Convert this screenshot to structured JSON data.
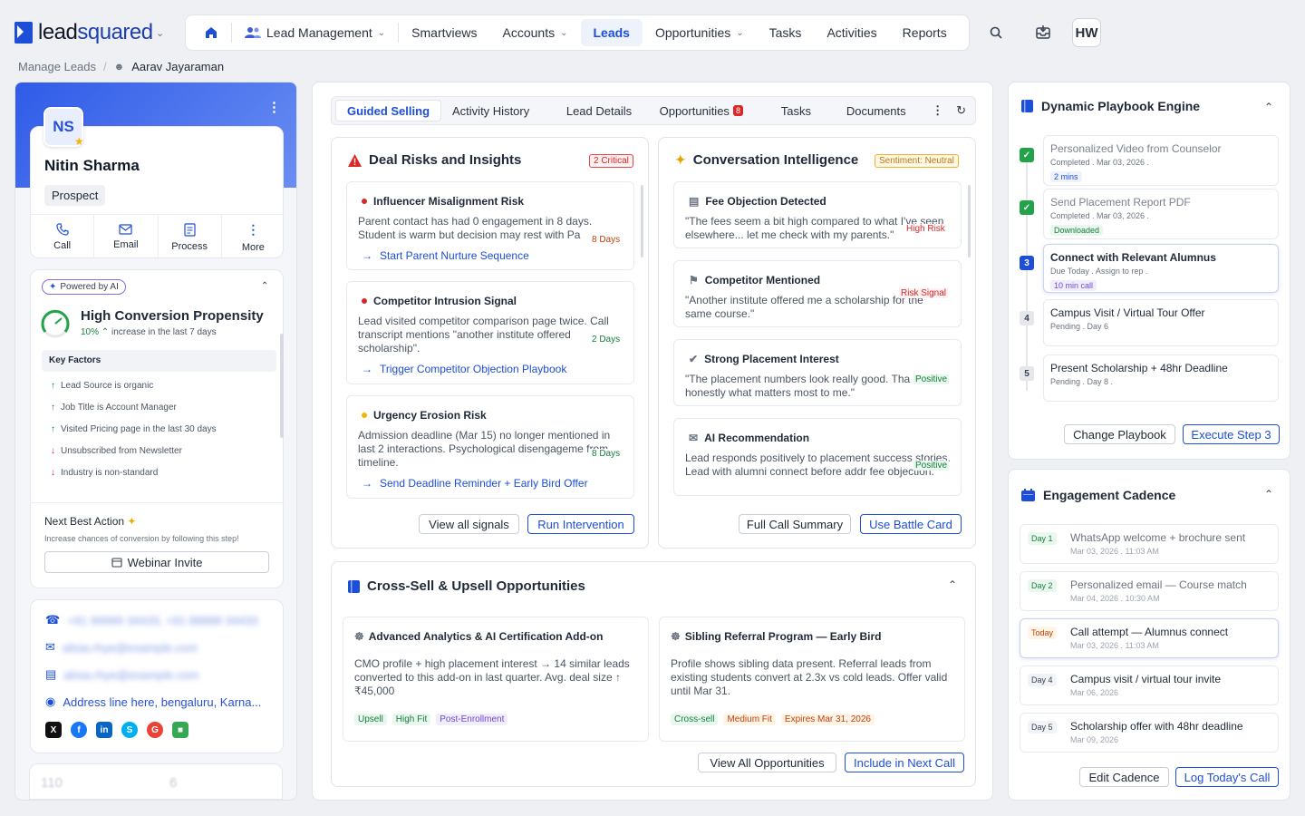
{
  "brand": {
    "name_a": "lead",
    "name_b": "squared"
  },
  "nav": {
    "module": "Lead Management",
    "items": [
      "Smartviews",
      "Accounts",
      "Leads",
      "Opportunities",
      "Tasks",
      "Activities",
      "Reports"
    ],
    "active": "Leads",
    "user_initials": "HW"
  },
  "breadcrumb": {
    "root": "Manage Leads",
    "current": "Aarav Jayaraman"
  },
  "profile": {
    "initials": "NS",
    "name": "Nitin Sharma",
    "status": "Prospect",
    "actions": [
      "Call",
      "Email",
      "Process",
      "More"
    ]
  },
  "ai": {
    "badge": "Powered by AI",
    "title": "High Conversion Propensity",
    "change_pct": "10%",
    "change_text": "increase in the last 7 days",
    "key_factors_label": "Key Factors",
    "factors": [
      {
        "text": "Lead Source is organic",
        "dir": "up"
      },
      {
        "text": "Job Title is Account Manager",
        "dir": "up"
      },
      {
        "text": "Visited Pricing page in the last 30 days",
        "dir": "up"
      },
      {
        "text": "Unsubscribed from Newsletter",
        "dir": "down"
      },
      {
        "text": "Industry is non-standard",
        "dir": "down"
      }
    ],
    "nba_title": "Next Best Action",
    "nba_sub": "Increase chances of conversion by following this step!",
    "nba_button": "Webinar Invite"
  },
  "contact": {
    "phone": "+91 99999 34433, +91 88888 34433",
    "email": "alisia.rhye@example.com",
    "alt_email": "alisia.rhye@example.com",
    "address": "Address line here, bengaluru, Karna..."
  },
  "stats": {
    "a": "110",
    "b": "6"
  },
  "tabs": [
    "Guided Selling",
    "Activity History",
    "Lead Details",
    "Opportunities",
    "Tasks",
    "Documents"
  ],
  "tabs_opportunity_count": "8",
  "deal_risks": {
    "title": "Deal Risks and Insights",
    "tag": "2 Critical",
    "items": [
      {
        "title": "Influencer Misalignment Risk",
        "body": "Parent contact has had 0 engagement in 8 days. Student is warm but decision may rest with Pa",
        "days": "8 Days",
        "link": "Start Parent Nurture Sequence"
      },
      {
        "title": "Competitor Intrusion Signal",
        "body": "Lead visited competitor comparison page twice. Call transcript mentions \"another institute offered scholarship\".",
        "days": "2 Days",
        "link": "Trigger Competitor Objection Playbook"
      },
      {
        "title": "Urgency Erosion Risk",
        "body": "Admission deadline (Mar 15) no longer mentioned in last 2 interactions. Psychological disengageme from timeline.",
        "days": "8 Days",
        "link": "Send Deadline Reminder + Early Bird Offer"
      }
    ],
    "btn_secondary": "View all signals",
    "btn_primary": "Run Intervention"
  },
  "conversation": {
    "title": "Conversation Intelligence",
    "tag": "Sentiment: Neutral",
    "items": [
      {
        "title": "Fee Objection Detected",
        "body": "\"The fees seem a bit high compared to what I've seen elsewhere... let me check with my parents.\"",
        "signal": "High Risk"
      },
      {
        "title": "Competitor Mentioned",
        "body": "\"Another institute offered me a scholarship for the same course.\"",
        "signal": "Risk Signal"
      },
      {
        "title": "Strong Placement Interest",
        "body": "\"The placement numbers look really good. Tha honestly what matters most to me.\"",
        "signal": "Positive"
      },
      {
        "title": "AI Recommendation",
        "body": "Lead responds positively to placement success stories. Lead with alumni connect before addr fee objection.",
        "signal": "Positive"
      }
    ],
    "btn_secondary": "Full Call Summary",
    "btn_primary": "Use Battle Card"
  },
  "cross_sell": {
    "title": "Cross-Sell & Upsell Opportunities",
    "items": [
      {
        "title": "Advanced Analytics & AI Certification Add-on",
        "body": "CMO profile + high placement interest → 14 similar leads converted to this add-on in last quarter. Avg. deal size ↑ ₹45,000",
        "tags": [
          "Upsell",
          "High Fit",
          "Post-Enrollment"
        ]
      },
      {
        "title": "Sibling Referral Program — Early Bird",
        "body": "Profile shows sibling data present. Referral leads from existing students convert at 2.3x vs cold leads. Offer valid until Mar 31.",
        "tags": [
          "Cross-sell",
          "Medium Fit",
          "Expires Mar 31, 2026"
        ]
      }
    ],
    "btn_secondary": "View All Opportunities",
    "btn_primary": "Include in Next Call"
  },
  "playbook": {
    "title": "Dynamic Playbook Engine",
    "steps": [
      {
        "marker": "",
        "state": "done",
        "title": "Personalized Video from Counselor",
        "sub": "Completed . Mar 03, 2026 .",
        "tag": "2 mins"
      },
      {
        "marker": "",
        "state": "done",
        "title": "Send Placement Report PDF",
        "sub": "Completed . Mar 03, 2026 .",
        "tag": "Downloaded"
      },
      {
        "marker": "3",
        "state": "cur",
        "title": "Connect with Relevant Alumnus",
        "sub": "Due Today . Assign to rep .",
        "tag": "10 min call"
      },
      {
        "marker": "4",
        "state": "pend",
        "title": "Campus Visit / Virtual Tour Offer",
        "sub": "Pending . Day 6",
        "tag": ""
      },
      {
        "marker": "5",
        "state": "pend",
        "title": "Present Scholarship + 48hr Deadline",
        "sub": "Pending .  Day 8 .",
        "tag": ""
      }
    ],
    "btn_secondary": "Change Playbook",
    "btn_primary": "Execute Step 3"
  },
  "cadence": {
    "title": "Engagement Cadence",
    "items": [
      {
        "day": "Day 1",
        "title": "WhatsApp welcome + brochure sent",
        "time": "Mar 03, 2026 .  11:03 AM",
        "state": "past"
      },
      {
        "day": "Day 2",
        "title": "Personalized email — Course match",
        "time": "Mar 04, 2026 .  10:30 AM",
        "state": "past"
      },
      {
        "day": "Today",
        "title": "Call attempt — Alumnus connect",
        "time": "Mar 03, 2026 .  11:03 AM",
        "state": "today"
      },
      {
        "day": "Day 4",
        "title": "Campus visit / virtual tour invite",
        "time": "Mar 06, 2026",
        "state": "future"
      },
      {
        "day": "Day 5",
        "title": "Scholarship offer with 48hr deadline",
        "time": "Mar 09, 2026",
        "state": "future"
      }
    ],
    "btn_secondary": "Edit Cadence",
    "btn_primary": "Log Today's Call"
  }
}
